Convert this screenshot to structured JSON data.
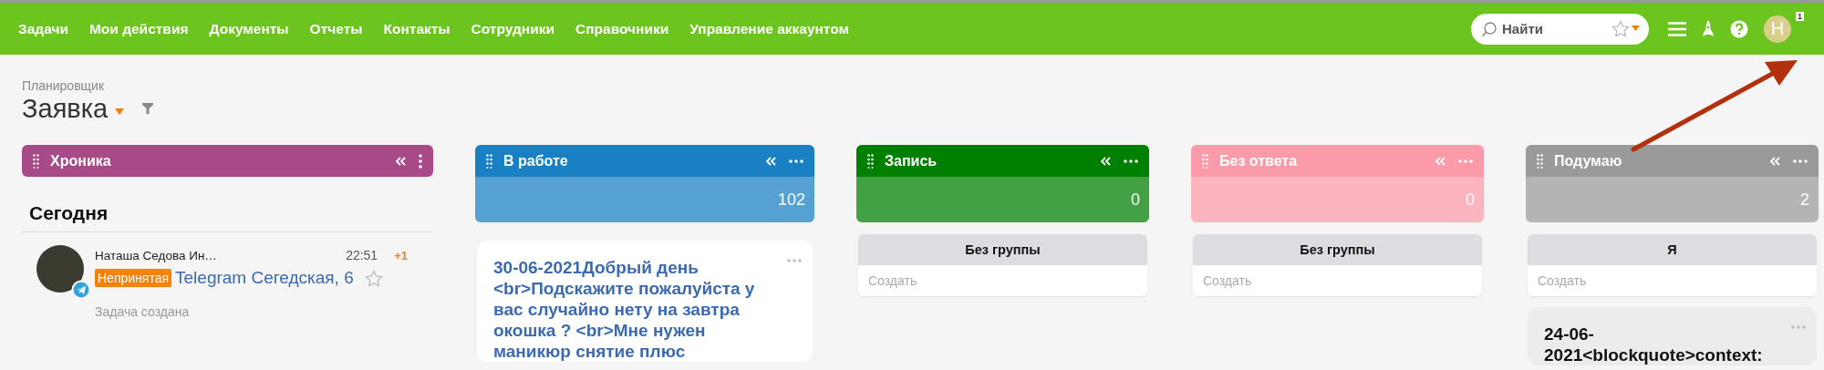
{
  "nav": [
    {
      "label": "Задачи"
    },
    {
      "label": "Мои действия"
    },
    {
      "label": "Документы"
    },
    {
      "label": "Отчеты"
    },
    {
      "label": "Контакты"
    },
    {
      "label": "Сотрудники"
    },
    {
      "label": "Справочники"
    },
    {
      "label": "Управление аккаунтом"
    }
  ],
  "search": {
    "placeholder": "Найти"
  },
  "user": {
    "initial": "Н",
    "notifications": "1"
  },
  "page": {
    "breadcrumb": "Планировщик",
    "title": "Заявка"
  },
  "columns": [
    {
      "kind": "timeline",
      "title": "Хроника",
      "color": "#a94a88",
      "sections": [
        {
          "heading": "Сегодня",
          "events": [
            {
              "name": "Наташа Седова Ин…",
              "time": "22:51",
              "count": "+1",
              "status": "Непринятая",
              "link": "Telegram Сегедская, 6",
              "note": "Задача создана"
            }
          ]
        }
      ]
    },
    {
      "kind": "stage",
      "title": "В работе",
      "color": "#1a80c4",
      "count": "102",
      "cards": [
        {
          "kind": "task",
          "text": "30-06-2021Добрый день <br>Подскажите пожалуйста у вас случайно нету на завтра окошка ? <br>Мне нужен маникюр снятие плюс"
        }
      ]
    },
    {
      "kind": "stage",
      "title": "Запись",
      "color": "#008000",
      "count": "0",
      "groups": [
        {
          "title": "Без группы",
          "action": "Создать"
        }
      ]
    },
    {
      "kind": "stage",
      "title": "Без ответа",
      "color": "#fb9aa8",
      "count": "0",
      "groups": [
        {
          "title": "Без группы",
          "action": "Создать"
        }
      ]
    },
    {
      "kind": "stage",
      "title": "Подумаю",
      "color": "#9a9a9a",
      "count": "2",
      "groups": [
        {
          "title": "Я",
          "action": "Создать"
        }
      ],
      "cards": [
        {
          "kind": "note",
          "text": "24-06-2021<blockquote>context:"
        }
      ]
    }
  ]
}
